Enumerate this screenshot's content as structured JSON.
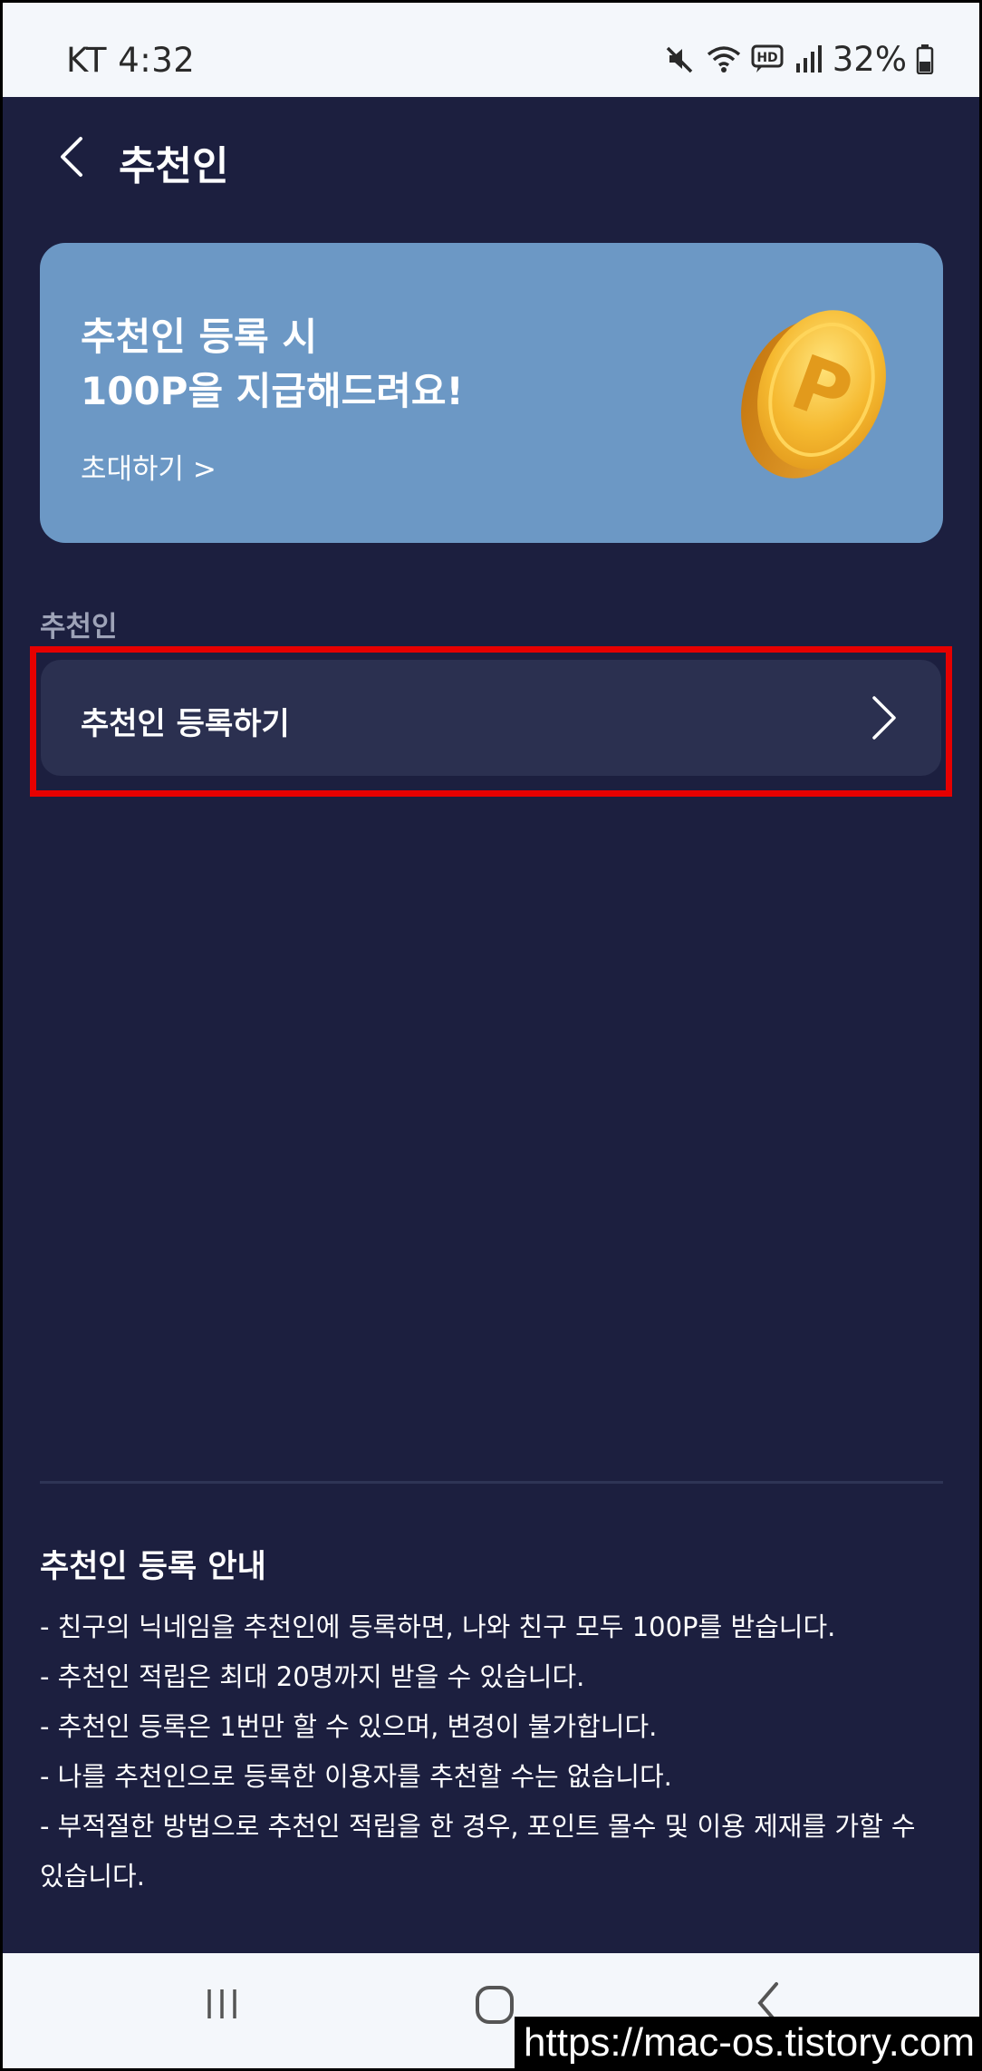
{
  "status_bar": {
    "time": "KT 4:32",
    "battery_percent": "32%",
    "icons": [
      "mute-icon",
      "wifi-icon",
      "hd-voice-icon",
      "signal-icon",
      "battery-icon"
    ]
  },
  "header": {
    "title": "추천인"
  },
  "banner": {
    "line1": "추천인 등록 시",
    "line2": "100P을 지급해드려요!",
    "link": "초대하기 >",
    "coin_letter": "P"
  },
  "section": {
    "label": "추천인",
    "register_label": "추천인 등록하기"
  },
  "info": {
    "title": "추천인 등록 안내",
    "items": [
      "- 친구의 닉네임을 추천인에 등록하면, 나와 친구 모두 100P를 받습니다.",
      "- 추천인 적립은 최대 20명까지 받을 수 있습니다.",
      "- 추천인 등록은 1번만 할 수 있으며, 변경이 불가합니다.",
      "- 나를 추천인으로 등록한 이용자를 추천할 수는 없습니다.",
      "- 부적절한 방법으로 추천인 적립을 한 경우, 포인트 몰수 및 이용 제재를 가할 수 있습니다."
    ]
  },
  "watermark": "https://mac-os.tistory.com",
  "colors": {
    "background": "#1c1f3f",
    "banner": "#6c98c5",
    "row": "#2b3050",
    "highlight": "#e60000"
  }
}
